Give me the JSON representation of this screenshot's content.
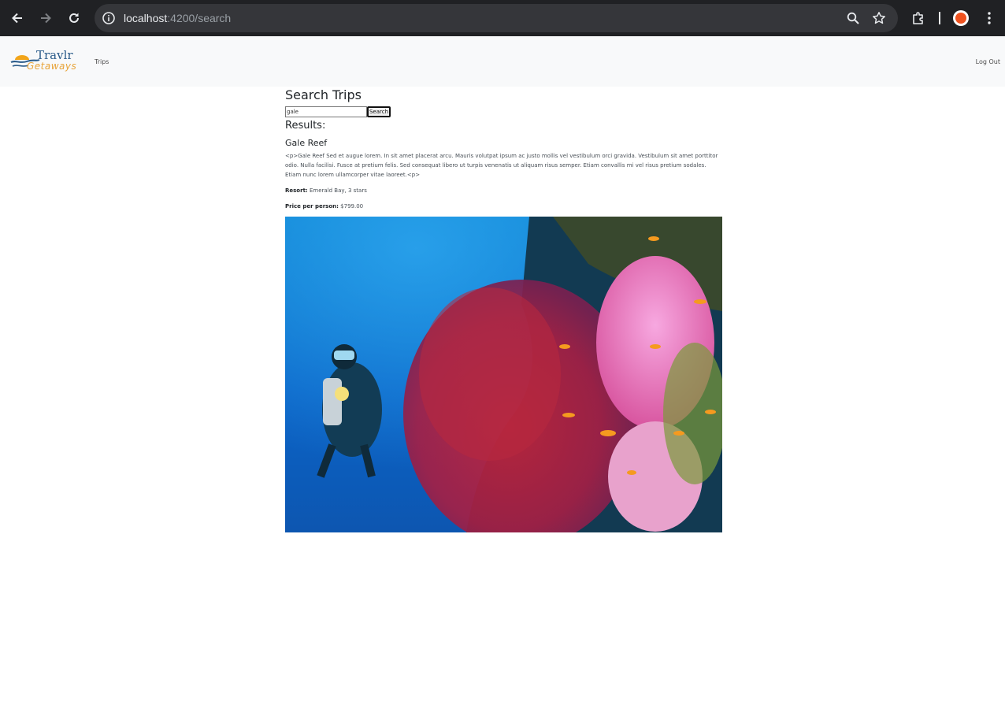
{
  "browser": {
    "url_host": "localhost",
    "url_path": ":4200/search"
  },
  "navbar": {
    "logo_top": "Travlr",
    "logo_bottom": "Getaways",
    "trips_label": "Trips",
    "logout_label": "Log Out"
  },
  "search": {
    "title": "Search Trips",
    "input_value": "gale",
    "button_label": "Search",
    "results_label": "Results:"
  },
  "result": {
    "name": "Gale Reef",
    "description": "<p>Gale Reef Sed et augue lorem. In sit amet placerat arcu. Mauris volutpat ipsum ac justo mollis vel vestibulum orci gravida. Vestibulum sit amet porttitor odio. Nulla facilisi. Fusce at pretium felis. Sed consequat libero ut turpis venenatis ut aliquam risus semper. Etiam convallis mi vel risus pretium sodales. Etiam nunc lorem ullamcorper vitae laoreet.<p>",
    "resort_label": "Resort:",
    "resort_value": "Emerald Bay, 3 stars",
    "price_label": "Price per person:",
    "price_value": "$799.00"
  },
  "colors": {
    "chrome_bg": "#202124",
    "omnibox_bg": "#35363a",
    "navbar_bg": "#f8f9fa",
    "logo_blue": "#2a5b8a",
    "logo_orange": "#e8a43a"
  }
}
